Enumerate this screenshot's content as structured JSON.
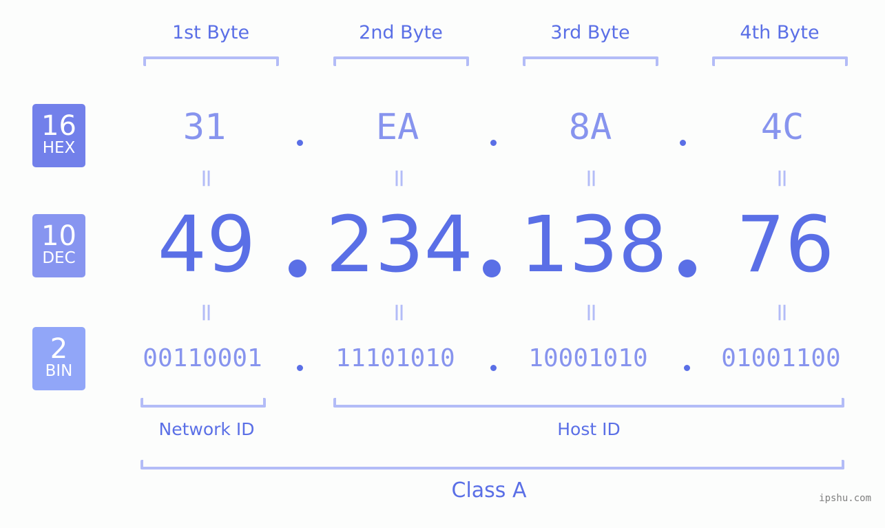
{
  "bytes": [
    {
      "label": "1st Byte",
      "hex": "31",
      "dec": "49",
      "bin": "00110001"
    },
    {
      "label": "2nd Byte",
      "hex": "EA",
      "dec": "234",
      "bin": "11101010"
    },
    {
      "label": "3rd Byte",
      "hex": "8A",
      "dec": "138",
      "bin": "10001010"
    },
    {
      "label": "4th Byte",
      "hex": "4C",
      "dec": "76",
      "bin": "01001100"
    }
  ],
  "badges": {
    "hex": {
      "num": "16",
      "label": "HEX",
      "color": "#7280ea"
    },
    "dec": {
      "num": "10",
      "label": "DEC",
      "color": "#8795f0"
    },
    "bin": {
      "num": "2",
      "label": "BIN",
      "color": "#91a6f8"
    }
  },
  "equals_sign": "=",
  "network_id_label": "Network ID",
  "host_id_label": "Host ID",
  "class_label": "Class A",
  "watermark": "ipshu.com",
  "colors": {
    "primary": "#5a6fe6",
    "secondary": "#8794ee",
    "light": "#b3bcf7",
    "background": "#fcfdfc"
  }
}
